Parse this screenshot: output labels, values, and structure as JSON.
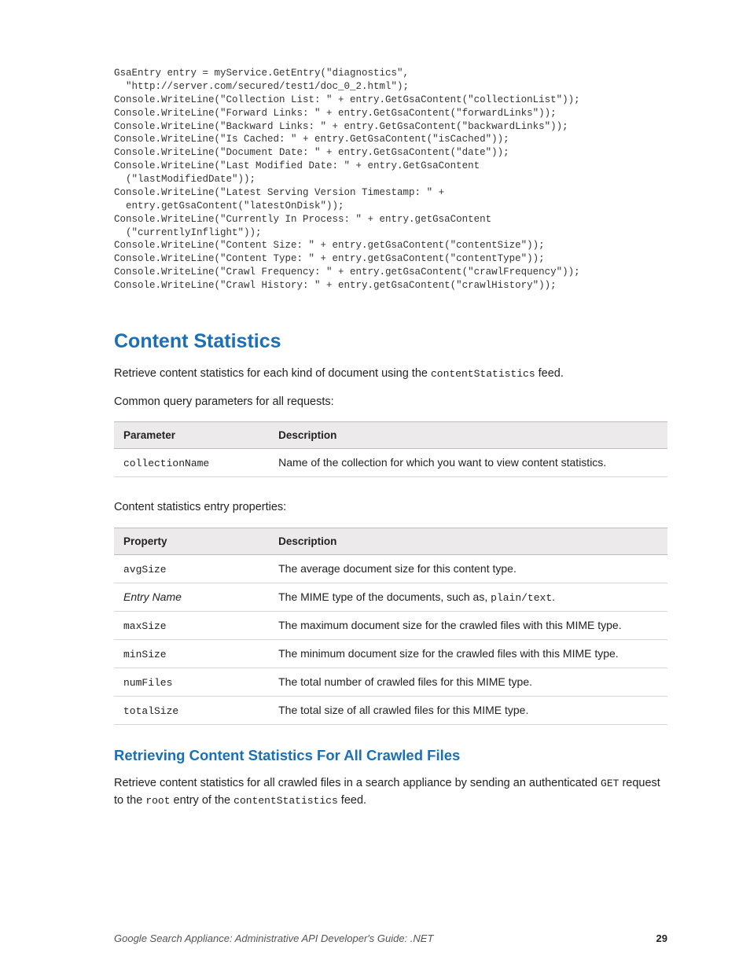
{
  "code_block": "GsaEntry entry = myService.GetEntry(\"diagnostics\",\n  \"http://server.com/secured/test1/doc_0_2.html\");\nConsole.WriteLine(\"Collection List: \" + entry.GetGsaContent(\"collectionList\"));\nConsole.WriteLine(\"Forward Links: \" + entry.GetGsaContent(\"forwardLinks\"));\nConsole.WriteLine(\"Backward Links: \" + entry.GetGsaContent(\"backwardLinks\"));\nConsole.WriteLine(\"Is Cached: \" + entry.GetGsaContent(\"isCached\"));\nConsole.WriteLine(\"Document Date: \" + entry.GetGsaContent(\"date\"));\nConsole.WriteLine(\"Last Modified Date: \" + entry.GetGsaContent\n  (\"lastModifiedDate\"));\nConsole.WriteLine(\"Latest Serving Version Timestamp: \" +\n  entry.getGsaContent(\"latestOnDisk\"));\nConsole.WriteLine(\"Currently In Process: \" + entry.getGsaContent\n  (\"currentlyInflight\"));\nConsole.WriteLine(\"Content Size: \" + entry.getGsaContent(\"contentSize\"));\nConsole.WriteLine(\"Content Type: \" + entry.getGsaContent(\"contentType\"));\nConsole.WriteLine(\"Crawl Frequency: \" + entry.getGsaContent(\"crawlFrequency\"));\nConsole.WriteLine(\"Crawl History: \" + entry.getGsaContent(\"crawlHistory\"));",
  "section": {
    "heading": "Content Statistics",
    "intro_pre": "Retrieve content statistics for each kind of document using the ",
    "intro_code": "contentStatistics",
    "intro_post": " feed.",
    "params_intro": "Common query parameters for all requests:",
    "table1": {
      "head": {
        "c0": "Parameter",
        "c1": "Description"
      },
      "rows": [
        {
          "c0": "collectionName",
          "c1": "Name of the collection for which you want to view content statistics."
        }
      ]
    },
    "props_intro": "Content statistics entry properties:",
    "table2": {
      "head": {
        "c0": "Property",
        "c1": "Description"
      },
      "rows": [
        {
          "c0": "avgSize",
          "mono": true,
          "c1_pre": "The average document size for this content type.",
          "c1_code": "",
          "c1_post": ""
        },
        {
          "c0": "Entry Name",
          "mono": false,
          "c1_pre": "The MIME type of the documents, such as, ",
          "c1_code": "plain/text",
          "c1_post": "."
        },
        {
          "c0": "maxSize",
          "mono": true,
          "c1_pre": "The maximum document size for the crawled files with this MIME type.",
          "c1_code": "",
          "c1_post": ""
        },
        {
          "c0": "minSize",
          "mono": true,
          "c1_pre": "The minimum document size for the crawled files with this MIME type.",
          "c1_code": "",
          "c1_post": ""
        },
        {
          "c0": "numFiles",
          "mono": true,
          "c1_pre": "The total number of crawled files for this MIME type.",
          "c1_code": "",
          "c1_post": ""
        },
        {
          "c0": "totalSize",
          "mono": true,
          "c1_pre": "The total size of all crawled files for this MIME type.",
          "c1_code": "",
          "c1_post": ""
        }
      ]
    }
  },
  "subsection": {
    "heading": "Retrieving Content Statistics For All Crawled Files",
    "p_pre": "Retrieve content statistics for all crawled files in a search appliance by sending an authenticated ",
    "p_code1": "GET",
    "p_mid": " request to the ",
    "p_code2": "root",
    "p_mid2": " entry of the ",
    "p_code3": "contentStatistics",
    "p_post": " feed."
  },
  "footer": {
    "title": "Google Search Appliance: Administrative API Developer's Guide: .NET",
    "page": "29"
  }
}
